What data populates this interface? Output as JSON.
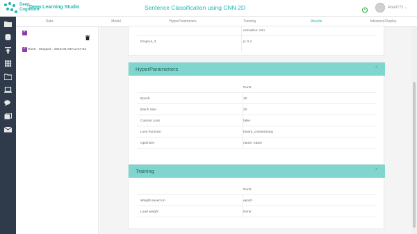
{
  "header": {
    "logo_word_1": "Deep",
    "logo_word_2": "Cognition",
    "brand": "Deep Learning Studio",
    "title": "Sentence Classification using CNN 2D",
    "username": "Roo0772",
    "accent_color": "#1fb5ad"
  },
  "sidebar_icons": [
    "folder-icon",
    "database-icon",
    "upload-icon",
    "grid-icon",
    "folder-open-icon",
    "laptop-icon",
    "chat-icon",
    "gallery-icon",
    "mail-icon"
  ],
  "tabs": [
    {
      "label": "Data"
    },
    {
      "label": "Model"
    },
    {
      "label": "HyperParameters"
    },
    {
      "label": "Training"
    },
    {
      "label": "Results"
    },
    {
      "label": "Inference/Deploy"
    }
  ],
  "runs": {
    "items": [
      {
        "label": "Run0 - Stopped - 2018-03-23T12:47:52"
      }
    ]
  },
  "top_card": {
    "rows": [
      {
        "key": "",
        "value": "activation: relu"
      },
      {
        "key": "Dropout_3",
        "value": "p: 0.4"
      }
    ]
  },
  "hyper_card": {
    "title": "HyperParamerters",
    "column": "Run0",
    "rows": [
      {
        "key": "Epoch",
        "value": "15"
      },
      {
        "key": "Batch Size",
        "value": "32"
      },
      {
        "key": "Custom Loss",
        "value": "false"
      },
      {
        "key": "Loss Function",
        "value": "binary_crossentropy"
      },
      {
        "key": "Optimizer",
        "value": "name: Adam"
      }
    ]
  },
  "training_card": {
    "title": "Training",
    "column": "Run0",
    "rows": [
      {
        "key": "Weight saved on",
        "value": "epoch"
      },
      {
        "key": "Load weight",
        "value": "None"
      }
    ]
  }
}
